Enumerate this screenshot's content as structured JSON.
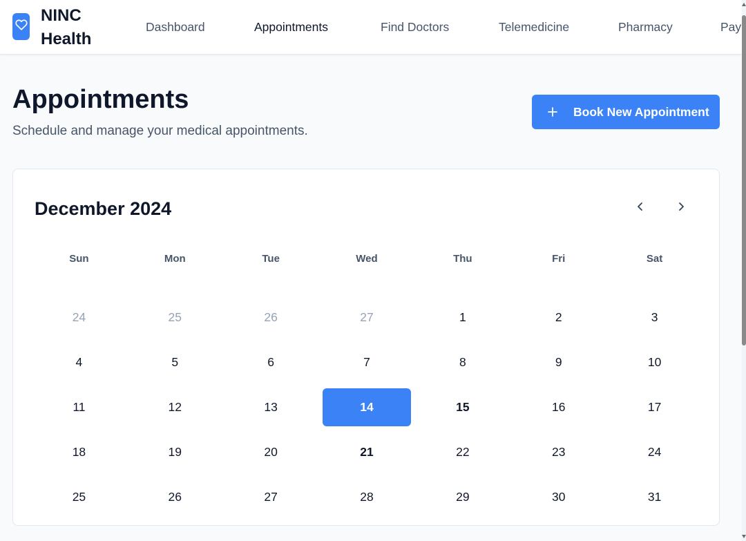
{
  "brand": {
    "name": "NINC Health",
    "icon": "heart-icon"
  },
  "nav": [
    {
      "label": "Dashboard",
      "active": false
    },
    {
      "label": "Appointments",
      "active": true
    },
    {
      "label": "Find Doctors",
      "active": false
    },
    {
      "label": "Telemedicine",
      "active": false
    },
    {
      "label": "Pharmacy",
      "active": false
    },
    {
      "label": "Payments",
      "active": false
    }
  ],
  "page": {
    "title": "Appointments",
    "subtitle": "Schedule and manage your medical appointments."
  },
  "actions": {
    "book_label": "Book New Appointment",
    "book_icon": "plus-icon"
  },
  "calendar": {
    "month_label": "December 2024",
    "prev_icon": "chevron-left-icon",
    "next_icon": "chevron-right-icon",
    "weekdays": [
      "Sun",
      "Mon",
      "Tue",
      "Wed",
      "Thu",
      "Fri",
      "Sat"
    ],
    "weeks": [
      [
        {
          "d": "24",
          "state": "muted"
        },
        {
          "d": "25",
          "state": "muted"
        },
        {
          "d": "26",
          "state": "muted"
        },
        {
          "d": "27",
          "state": "muted"
        },
        {
          "d": "1",
          "state": ""
        },
        {
          "d": "2",
          "state": ""
        },
        {
          "d": "3",
          "state": ""
        }
      ],
      [
        {
          "d": "4",
          "state": ""
        },
        {
          "d": "5",
          "state": ""
        },
        {
          "d": "6",
          "state": ""
        },
        {
          "d": "7",
          "state": ""
        },
        {
          "d": "8",
          "state": ""
        },
        {
          "d": "9",
          "state": ""
        },
        {
          "d": "10",
          "state": ""
        }
      ],
      [
        {
          "d": "11",
          "state": ""
        },
        {
          "d": "12",
          "state": ""
        },
        {
          "d": "13",
          "state": ""
        },
        {
          "d": "14",
          "state": "selected"
        },
        {
          "d": "15",
          "state": "bold"
        },
        {
          "d": "16",
          "state": ""
        },
        {
          "d": "17",
          "state": ""
        }
      ],
      [
        {
          "d": "18",
          "state": ""
        },
        {
          "d": "19",
          "state": ""
        },
        {
          "d": "20",
          "state": ""
        },
        {
          "d": "21",
          "state": "bold"
        },
        {
          "d": "22",
          "state": ""
        },
        {
          "d": "23",
          "state": ""
        },
        {
          "d": "24",
          "state": ""
        }
      ],
      [
        {
          "d": "25",
          "state": ""
        },
        {
          "d": "26",
          "state": ""
        },
        {
          "d": "27",
          "state": ""
        },
        {
          "d": "28",
          "state": ""
        },
        {
          "d": "29",
          "state": ""
        },
        {
          "d": "30",
          "state": ""
        },
        {
          "d": "31",
          "state": ""
        }
      ]
    ]
  },
  "colors": {
    "accent": "#3b82f6",
    "text": "#0f172a",
    "muted": "#94a3b8",
    "secondary": "#475569"
  }
}
